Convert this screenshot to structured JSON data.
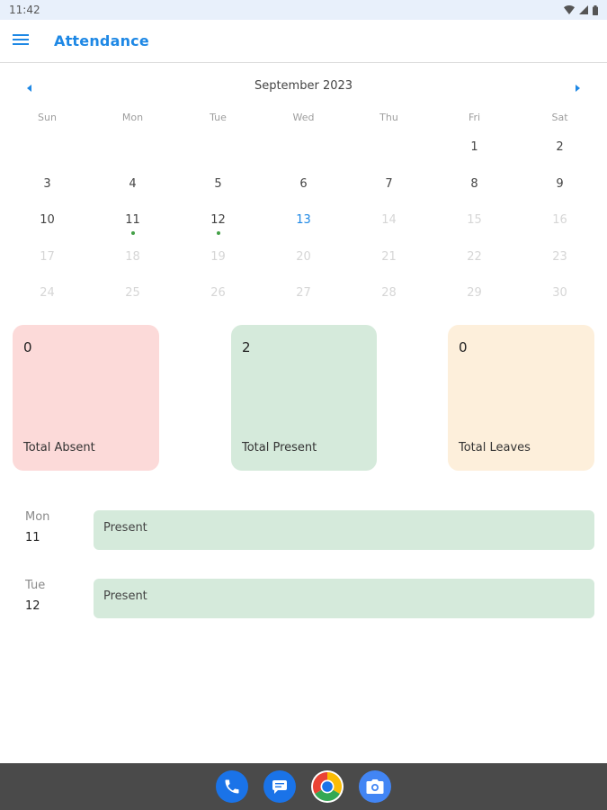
{
  "status_bar": {
    "time": "11:42",
    "icons": [
      "wifi-icon",
      "signal-icon",
      "battery-icon"
    ]
  },
  "app_bar": {
    "title": "Attendance",
    "menu_icon": "menu-icon"
  },
  "calendar": {
    "month_label": "September 2023",
    "weekdays": [
      "Sun",
      "Mon",
      "Tue",
      "Wed",
      "Thu",
      "Fri",
      "Sat"
    ],
    "rows": [
      [
        "",
        "",
        "",
        "",
        "",
        "1",
        "2"
      ],
      [
        "3",
        "4",
        "5",
        "6",
        "7",
        "8",
        "9"
      ],
      [
        "10",
        "11",
        "12",
        "13",
        "14",
        "15",
        "16"
      ],
      [
        "17",
        "18",
        "19",
        "20",
        "21",
        "22",
        "23"
      ],
      [
        "24",
        "25",
        "26",
        "27",
        "28",
        "29",
        "30"
      ]
    ],
    "today": "13",
    "future_days_start": 14,
    "marked_days": [
      "11",
      "12"
    ],
    "marked_color": "#43a047",
    "accent_color": "#1e88e5"
  },
  "summary": {
    "absent": {
      "value": "0",
      "label": "Total Absent",
      "color": "#fcdad9"
    },
    "present": {
      "value": "2",
      "label": "Total Present",
      "color": "#d5eadb"
    },
    "leaves": {
      "value": "0",
      "label": "Total Leaves",
      "color": "#fdefdb"
    }
  },
  "attendance_list": [
    {
      "weekday": "Mon",
      "date": "11",
      "status": "Present"
    },
    {
      "weekday": "Tue",
      "date": "12",
      "status": "Present"
    }
  ],
  "dock": {
    "apps": [
      "phone-icon",
      "messages-icon",
      "chrome-icon",
      "camera-icon"
    ]
  }
}
